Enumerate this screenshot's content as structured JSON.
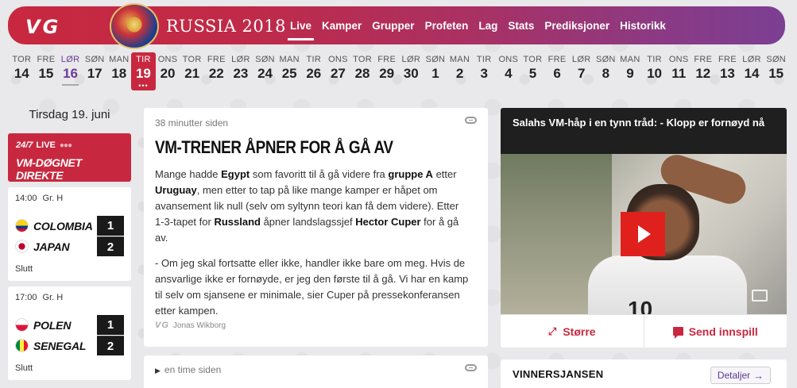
{
  "header": {
    "logo": "VG",
    "brand": "RUSSIA 2018",
    "nav": [
      {
        "label": "Live",
        "active": true
      },
      {
        "label": "Kamper",
        "active": false
      },
      {
        "label": "Grupper",
        "active": false
      },
      {
        "label": "Profeten",
        "active": false
      },
      {
        "label": "Lag",
        "active": false
      },
      {
        "label": "Stats",
        "active": false
      },
      {
        "label": "Prediksjoner",
        "active": false
      },
      {
        "label": "Historikk",
        "active": false
      }
    ]
  },
  "dates": [
    {
      "dn": "TOR",
      "dd": "14"
    },
    {
      "dn": "FRE",
      "dd": "15"
    },
    {
      "dn": "LØR",
      "dd": "16",
      "state": "visited"
    },
    {
      "dn": "SØN",
      "dd": "17"
    },
    {
      "dn": "MAN",
      "dd": "18"
    },
    {
      "dn": "TIR",
      "dd": "19",
      "state": "today",
      "dots": "•••"
    },
    {
      "dn": "ONS",
      "dd": "20"
    },
    {
      "dn": "TOR",
      "dd": "21"
    },
    {
      "dn": "FRE",
      "dd": "22"
    },
    {
      "dn": "LØR",
      "dd": "23"
    },
    {
      "dn": "SØN",
      "dd": "24"
    },
    {
      "dn": "MAN",
      "dd": "25"
    },
    {
      "dn": "TIR",
      "dd": "26"
    },
    {
      "dn": "ONS",
      "dd": "27"
    },
    {
      "dn": "TOR",
      "dd": "28"
    },
    {
      "dn": "FRE",
      "dd": "29"
    },
    {
      "dn": "LØR",
      "dd": "30"
    },
    {
      "dn": "SØN",
      "dd": "1"
    },
    {
      "dn": "MAN",
      "dd": "2"
    },
    {
      "dn": "TIR",
      "dd": "3"
    },
    {
      "dn": "ONS",
      "dd": "4"
    },
    {
      "dn": "TOR",
      "dd": "5"
    },
    {
      "dn": "FRE",
      "dd": "6"
    },
    {
      "dn": "LØR",
      "dd": "7"
    },
    {
      "dn": "SØN",
      "dd": "8"
    },
    {
      "dn": "MAN",
      "dd": "9"
    },
    {
      "dn": "TIR",
      "dd": "10"
    },
    {
      "dn": "ONS",
      "dd": "11"
    },
    {
      "dn": "FRE",
      "dd": "12"
    },
    {
      "dn": "FRE",
      "dd": "13"
    },
    {
      "dn": "LØR",
      "dd": "14"
    },
    {
      "dn": "SØN",
      "dd": "15"
    }
  ],
  "left": {
    "date_heading": "Tirsdag 19. juni",
    "live": {
      "hours": "24/7",
      "label": "LIVE",
      "title": "VM-DØGNET DIREKTE"
    },
    "matches": [
      {
        "time": "14:00",
        "group": "Gr. H",
        "home": "COLOMBIA",
        "away": "JAPAN",
        "home_score": "1",
        "away_score": "2",
        "status": "Slutt"
      },
      {
        "time": "17:00",
        "group": "Gr. H",
        "home": "POLEN",
        "away": "SENEGAL",
        "home_score": "1",
        "away_score": "2",
        "status": "Slutt"
      }
    ]
  },
  "article": {
    "time": "38 minutter siden",
    "title": "VM-TRENER ÅPNER FOR Å GÅ AV",
    "p1_parts": [
      "Mange hadde ",
      "Egypt",
      " som favoritt til å gå videre fra ",
      "gruppe A",
      " etter ",
      "Uruguay",
      ", men etter to tap på like mange kamper er håpet om avansement lik null (selv om syltynn teori kan få dem videre). Etter 1-3-tapet for ",
      "Russland",
      " åpner landslagssjef ",
      "Hector Cuper",
      " for å gå av."
    ],
    "p2": "- Om jeg skal fortsatte eller ikke, handler ikke bare om meg. Hvis de ansvarlige ikke er fornøyde, er jeg den første til å gå. Vi har en kamp til selv om sjansene er minimale, sier Cuper på pressekonferansen etter kampen.",
    "byline_logo": "VG",
    "byline": "Jonas Wikborg"
  },
  "article2": {
    "time": "en time siden",
    "play": "▶"
  },
  "video": {
    "title": "Salahs VM-håp i en tynn tråd: - Klopp er fornøyd nå",
    "jersey_number": "10",
    "bigger": "Større",
    "bigger_icon": "⤢",
    "feedback": "Send innspill"
  },
  "winner": {
    "title": "VINNERSJANSEN",
    "details": "Detaljer",
    "details_arrow": "→"
  }
}
